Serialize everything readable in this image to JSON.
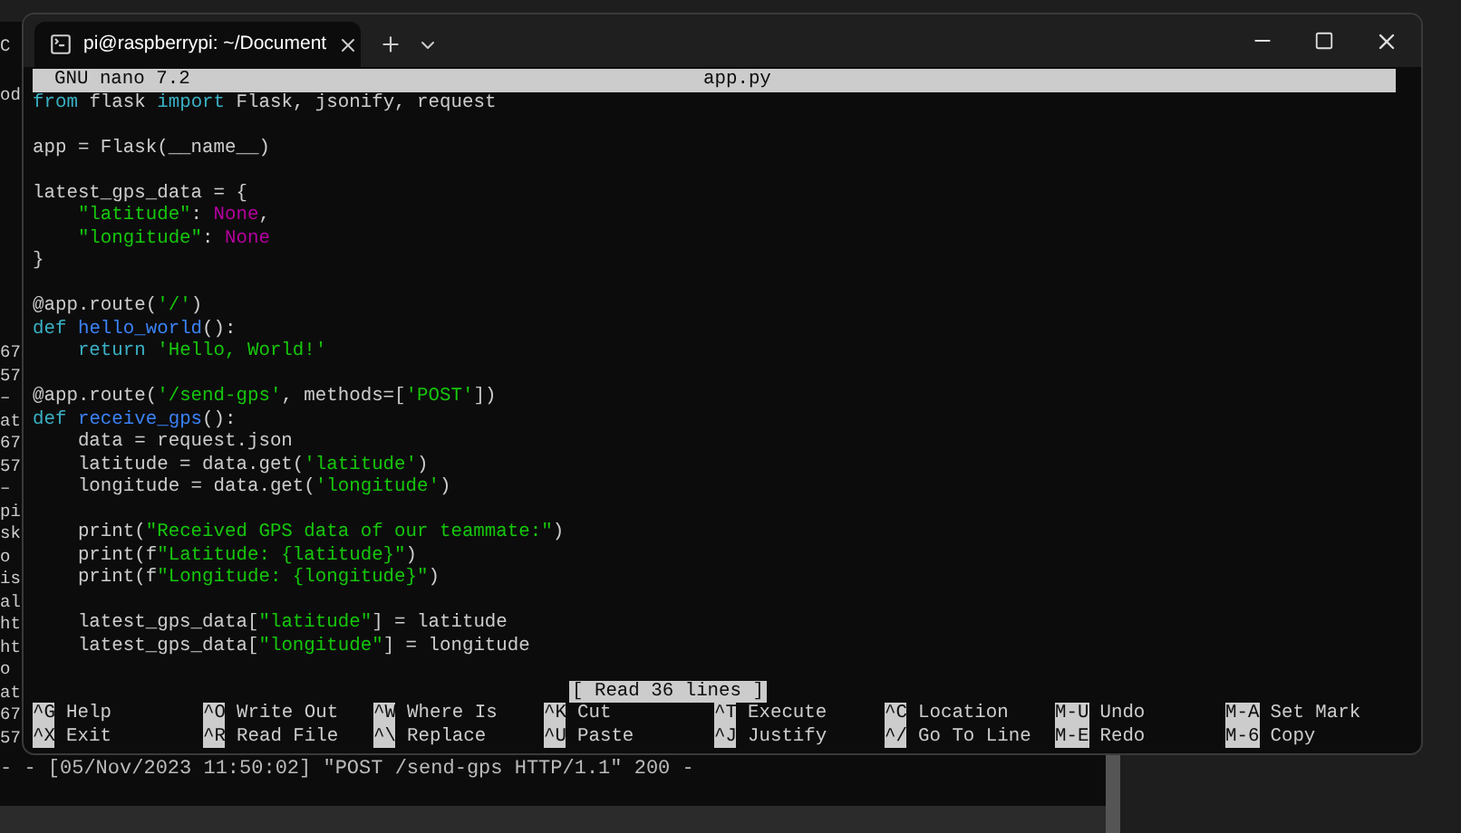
{
  "behind_window_fragments": [
    "C",
    "od"
  ],
  "background_terminal": {
    "lines": [
      "67",
      "57",
      "–",
      "at",
      "67",
      "57",
      "–",
      "pi",
      "sk",
      "o",
      "is",
      "al",
      "ht",
      "ht",
      "o",
      "at",
      "67",
      "57"
    ],
    "log_line": "- - [05/Nov/2023 11:50:02] \"POST /send-gps HTTP/1.1\" 200 -"
  },
  "window": {
    "tabs": [
      {
        "title": "pi@raspberrypi: ~/Document",
        "selected": true
      }
    ]
  },
  "nano": {
    "version": "GNU nano 7.2",
    "filename": "app.py",
    "blocks": [
      [
        {
          "tokens": [
            {
              "kind": "kw",
              "text": "from"
            },
            {
              "kind": "plain",
              "text": " flask "
            },
            {
              "kind": "kw",
              "text": "import"
            },
            {
              "kind": "plain",
              "text": " Flask, jsonify, request"
            }
          ]
        }
      ],
      [
        {
          "tokens": [
            {
              "kind": "plain",
              "text": "app = Flask(__name__)"
            }
          ]
        }
      ],
      [
        {
          "tokens": [
            {
              "kind": "plain",
              "text": "latest_gps_data = {"
            }
          ]
        },
        {
          "tokens": [
            {
              "kind": "str",
              "text": "    \"latitude\""
            },
            {
              "kind": "plain",
              "text": ": "
            },
            {
              "kind": "const",
              "text": "None"
            },
            {
              "kind": "plain",
              "text": ","
            }
          ]
        },
        {
          "tokens": [
            {
              "kind": "str",
              "text": "    \"longitude\""
            },
            {
              "kind": "plain",
              "text": ": "
            },
            {
              "kind": "const",
              "text": "None"
            }
          ]
        },
        {
          "tokens": [
            {
              "kind": "plain",
              "text": "}"
            }
          ]
        }
      ],
      [
        {
          "tokens": [
            {
              "kind": "plain",
              "text": "@app.route("
            },
            {
              "kind": "str",
              "text": "'/'"
            },
            {
              "kind": "plain",
              "text": ")"
            }
          ]
        },
        {
          "tokens": [
            {
              "kind": "kw",
              "text": "def "
            },
            {
              "kind": "func",
              "text": "hello_world"
            },
            {
              "kind": "plain",
              "text": "():"
            }
          ]
        },
        {
          "tokens": [
            {
              "kind": "kw",
              "text": "    return "
            },
            {
              "kind": "str",
              "text": "'Hello, World!'"
            }
          ]
        }
      ],
      [
        {
          "tokens": [
            {
              "kind": "plain",
              "text": "@app.route("
            },
            {
              "kind": "str",
              "text": "'/send-gps'"
            },
            {
              "kind": "plain",
              "text": ", methods=["
            },
            {
              "kind": "str",
              "text": "'POST'"
            },
            {
              "kind": "plain",
              "text": "])"
            }
          ]
        },
        {
          "tokens": [
            {
              "kind": "kw",
              "text": "def "
            },
            {
              "kind": "func",
              "text": "receive_gps"
            },
            {
              "kind": "plain",
              "text": "():"
            }
          ]
        },
        {
          "tokens": [
            {
              "kind": "plain",
              "text": "    data = request.json"
            }
          ]
        },
        {
          "tokens": [
            {
              "kind": "plain",
              "text": "    latitude = data.get("
            },
            {
              "kind": "str",
              "text": "'latitude'"
            },
            {
              "kind": "plain",
              "text": ")"
            }
          ]
        },
        {
          "tokens": [
            {
              "kind": "plain",
              "text": "    longitude = data.get("
            },
            {
              "kind": "str",
              "text": "'longitude'"
            },
            {
              "kind": "plain",
              "text": ")"
            }
          ]
        }
      ],
      [
        {
          "tokens": [
            {
              "kind": "plain",
              "text": "    print("
            },
            {
              "kind": "str",
              "text": "\"Received GPS data of our teammate:\""
            },
            {
              "kind": "plain",
              "text": ")"
            }
          ]
        },
        {
          "tokens": [
            {
              "kind": "plain",
              "text": "    print(f"
            },
            {
              "kind": "str",
              "text": "\"Latitude: {latitude}\""
            },
            {
              "kind": "plain",
              "text": ")"
            }
          ]
        },
        {
          "tokens": [
            {
              "kind": "plain",
              "text": "    print(f"
            },
            {
              "kind": "str",
              "text": "\"Longitude: {longitude}\""
            },
            {
              "kind": "plain",
              "text": ")"
            }
          ]
        }
      ],
      [
        {
          "tokens": [
            {
              "kind": "plain",
              "text": "    latest_gps_data["
            },
            {
              "kind": "str",
              "text": "\"latitude\""
            },
            {
              "kind": "plain",
              "text": "] = latitude"
            }
          ]
        },
        {
          "tokens": [
            {
              "kind": "plain",
              "text": "    latest_gps_data["
            },
            {
              "kind": "str",
              "text": "\"longitude\""
            },
            {
              "kind": "plain",
              "text": "] = longitude"
            }
          ]
        }
      ]
    ],
    "status": "[ Read 36 lines ]",
    "shortcuts": [
      {
        "key": "^G",
        "label": "Help"
      },
      {
        "key": "^O",
        "label": "Write Out"
      },
      {
        "key": "^W",
        "label": "Where Is"
      },
      {
        "key": "^K",
        "label": "Cut"
      },
      {
        "key": "^T",
        "label": "Execute"
      },
      {
        "key": "^C",
        "label": "Location"
      },
      {
        "key": "M-U",
        "label": "Undo"
      },
      {
        "key": "M-A",
        "label": "Set Mark"
      },
      {
        "key": "^X",
        "label": "Exit"
      },
      {
        "key": "^R",
        "label": "Read File"
      },
      {
        "key": "^\\",
        "label": "Replace"
      },
      {
        "key": "^U",
        "label": "Paste"
      },
      {
        "key": "^J",
        "label": "Justify"
      },
      {
        "key": "^/",
        "label": "Go To Line"
      },
      {
        "key": "M-E",
        "label": "Redo"
      },
      {
        "key": "M-6",
        "label": "Copy"
      }
    ]
  }
}
